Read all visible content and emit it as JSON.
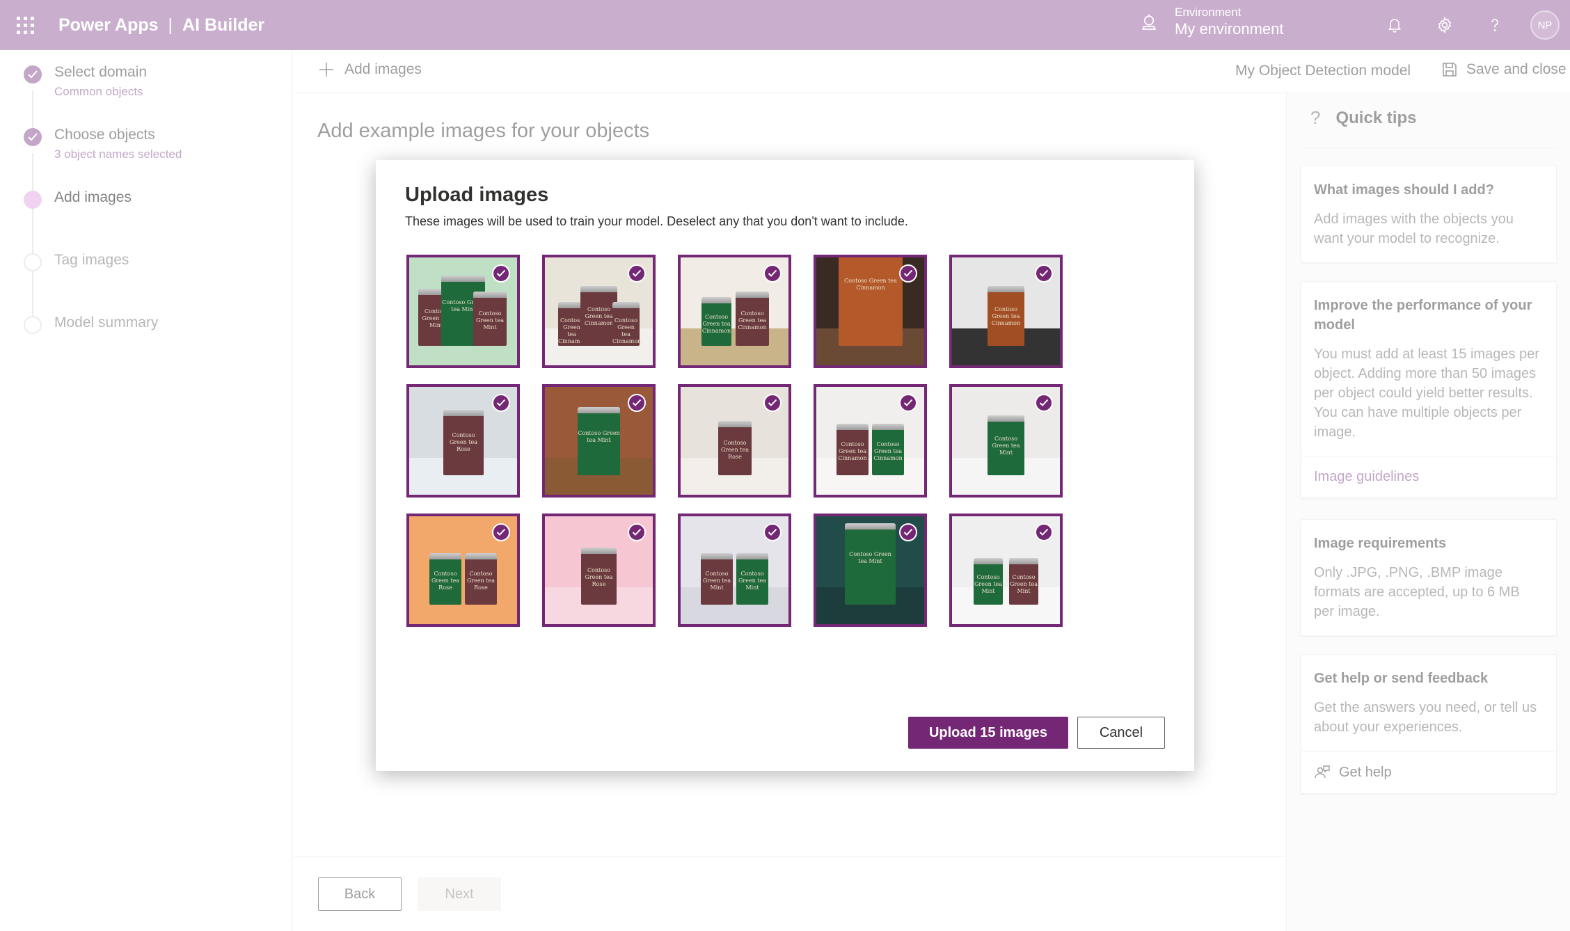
{
  "header": {
    "app_name": "Power Apps",
    "separator": "|",
    "product": "AI Builder",
    "environment_label": "Environment",
    "environment_name": "My environment",
    "avatar_initials": "NP"
  },
  "steps": [
    {
      "title": "Select domain",
      "subtitle": "Common objects",
      "state": "done"
    },
    {
      "title": "Choose objects",
      "subtitle": "3 object names selected",
      "state": "done"
    },
    {
      "title": "Add images",
      "subtitle": "",
      "state": "current"
    },
    {
      "title": "Tag images",
      "subtitle": "",
      "state": "todo"
    },
    {
      "title": "Model summary",
      "subtitle": "",
      "state": "todo"
    }
  ],
  "command_bar": {
    "add_images": "Add images",
    "model_name": "My Object Detection model",
    "save_close": "Save and close"
  },
  "page": {
    "title": "Add example images for your objects"
  },
  "footer": {
    "back": "Back",
    "next": "Next"
  },
  "tips": {
    "title": "Quick tips",
    "cards": [
      {
        "title": "What images should I add?",
        "body": "Add images with the objects you want your model to recognize.",
        "link": ""
      },
      {
        "title": "Improve the performance of your model",
        "body": "You must add at least 15 images per object. Adding more than 50 images per object could yield better results. You can have multiple objects per image.",
        "link": "Image guidelines"
      },
      {
        "title": "Image requirements",
        "body": "Only .JPG, .PNG, .BMP image formats are accepted, up to 6 MB per image.",
        "link": ""
      },
      {
        "title": "Get help or send feedback",
        "body": "Get the answers you need, or tell us about your experiences.",
        "link": "Get help"
      }
    ]
  },
  "modal": {
    "title": "Upload images",
    "subtitle": "These images will be used to train your model. Deselect any that you don't want to include.",
    "upload_button": "Upload 15 images",
    "cancel_button": "Cancel",
    "images": [
      {
        "selected": true,
        "bg": "#bfe0c4",
        "surface": "#bfe0c4",
        "cans": [
          [
            "#6b3a3f",
            0.32
          ],
          [
            "#1f6a3a",
            0.42
          ],
          [
            "#6b3a3f",
            0.3
          ]
        ],
        "label": "Contoso Green tea Mint"
      },
      {
        "selected": true,
        "bg": "#e9e4da",
        "surface": "#f2f0ec",
        "cans": [
          [
            "#6b3a3f",
            0.22
          ],
          [
            "#6b3a3f",
            0.34
          ],
          [
            "#6b3a3f",
            0.22
          ]
        ],
        "label": "Contoso Green tea Cinnamon"
      },
      {
        "selected": true,
        "bg": "#f1ede6",
        "surface": "#c9b48a",
        "cans": [
          [
            "#1f6a3a",
            0.26
          ],
          [
            "#6b3a3f",
            0.3
          ]
        ],
        "label": "Contoso Green tea Cinnamon"
      },
      {
        "selected": true,
        "bg": "#3a2a24",
        "surface": "#6a4a35",
        "cans": [
          [
            "#b45a2a",
            0.66
          ]
        ],
        "label": "Contoso Green tea Cinnamon"
      },
      {
        "selected": true,
        "bg": "#e6e6e6",
        "surface": "#333333",
        "cans": [
          [
            "#a24e24",
            0.34
          ]
        ],
        "label": "Contoso Green tea Cinnamon"
      },
      {
        "selected": true,
        "bg": "#d8dde2",
        "surface": "#e9eef2",
        "cans": [
          [
            "#6b3a3f",
            0.38
          ]
        ],
        "label": "Contoso Green tea Rose"
      },
      {
        "selected": true,
        "bg": "#9a5a3a",
        "surface": "#8a5a35",
        "cans": [
          [
            "#1f6a3a",
            0.4
          ]
        ],
        "label": "Contoso Green tea Mint"
      },
      {
        "selected": true,
        "bg": "#e8e2dc",
        "surface": "#f2eeea",
        "cans": [
          [
            "#6b3a3f",
            0.3
          ]
        ],
        "label": "Contoso Green tea Rose"
      },
      {
        "selected": true,
        "bg": "#f1efed",
        "surface": "#f7f6f5",
        "cans": [
          [
            "#6b3a3f",
            0.28
          ],
          [
            "#1f6a3a",
            0.28
          ]
        ],
        "label": "Contoso Green tea Cinnamon"
      },
      {
        "selected": true,
        "bg": "#ecebea",
        "surface": "#f5f5f5",
        "cans": [
          [
            "#1f6a3a",
            0.34
          ]
        ],
        "label": "Contoso Green tea Mint"
      },
      {
        "selected": true,
        "bg": "#f1a86a",
        "surface": "#f1a86a",
        "cans": [
          [
            "#1f6a3a",
            0.28
          ],
          [
            "#6b3a3f",
            0.28
          ]
        ],
        "label": "Contoso Green tea Rose"
      },
      {
        "selected": true,
        "bg": "#f6c6d2",
        "surface": "#f7d8e0",
        "cans": [
          [
            "#6b3a3f",
            0.32
          ]
        ],
        "label": "Contoso Green tea Rose"
      },
      {
        "selected": true,
        "bg": "#e4e4ea",
        "surface": "#d8d8e0",
        "cans": [
          [
            "#6b3a3f",
            0.28
          ],
          [
            "#1f6a3a",
            0.28
          ]
        ],
        "label": "Contoso Green tea Mint"
      },
      {
        "selected": true,
        "bg": "#224c4a",
        "surface": "#1c3d3b",
        "cans": [
          [
            "#1f6a3a",
            0.5
          ]
        ],
        "label": "Contoso Green tea Mint"
      },
      {
        "selected": true,
        "bg": "#efefef",
        "surface": "#f7f7f7",
        "cans": [
          [
            "#1f6a3a",
            0.24
          ],
          [
            "#6b3a3f",
            0.24
          ]
        ],
        "label": "Contoso Green tea Mint"
      }
    ]
  },
  "colors": {
    "header": "#a778ad",
    "accent": "#742774",
    "step_done": "#9b6ba4",
    "step_current": "#e9b4ec"
  }
}
